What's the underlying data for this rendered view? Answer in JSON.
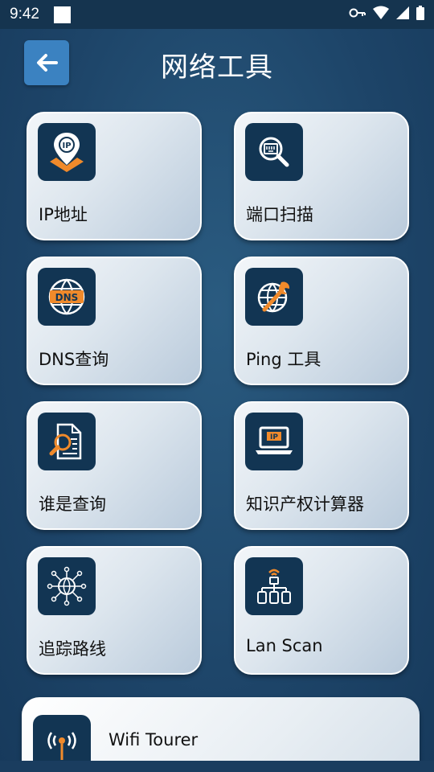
{
  "status_bar": {
    "time": "9:42"
  },
  "header": {
    "title": "网络工具"
  },
  "colors": {
    "accent": "#3b82c1",
    "icon_bg": "#123553",
    "icon_orange": "#f08a2b"
  },
  "tools": [
    {
      "label": "IP地址",
      "icon": "ip-location-icon"
    },
    {
      "label": "端口扫描",
      "icon": "port-scan-icon"
    },
    {
      "label": "DNS查询",
      "icon": "dns-globe-icon"
    },
    {
      "label": "Ping 工具",
      "icon": "globe-wrench-icon"
    },
    {
      "label": "谁是查询",
      "icon": "document-search-icon"
    },
    {
      "label": "知识产权计算器",
      "icon": "ip-laptop-icon"
    },
    {
      "label": "追踪路线",
      "icon": "network-globe-icon"
    },
    {
      "label": "Lan Scan",
      "icon": "lan-devices-icon"
    }
  ],
  "wifi_card": {
    "label": "Wifi Tourer",
    "icon": "wifi-antenna-icon"
  },
  "icon_text": {
    "ip": "IP",
    "dns": "DNS"
  }
}
